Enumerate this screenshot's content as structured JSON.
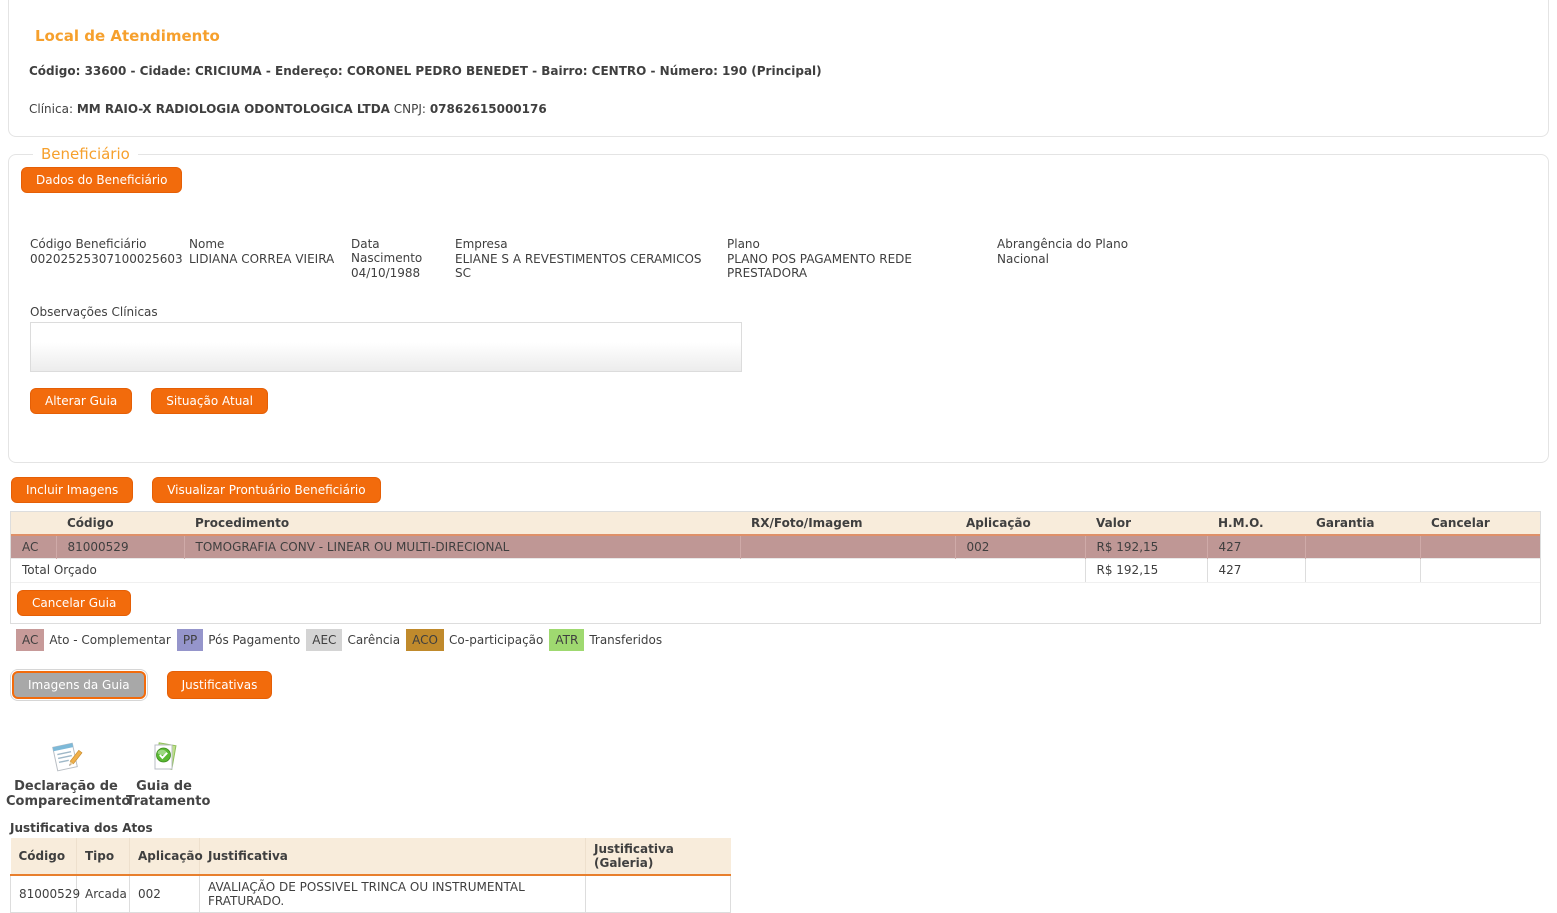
{
  "local_atendimento": {
    "title": "Local de Atendimento",
    "info_line": "Código: 33600 - Cidade: CRICIUMA - Endereço: CORONEL PEDRO BENEDET - Bairro: CENTRO - Número: 190 (Principal)",
    "clinica_label": "Clínica:",
    "clinica_nome": "MM RAIO-X RADIOLOGIA ODONTOLOGICA LTDA",
    "cnpj_label": "CNPJ:",
    "cnpj_valor": "07862615000176"
  },
  "beneficiario": {
    "legend": "Beneficiário",
    "dados_button": "Dados do Beneficiário",
    "fields": [
      {
        "label": "Código Beneficiário",
        "value": "00202525307100025603"
      },
      {
        "label": "Nome",
        "value": "LIDIANA CORREA VIEIRA"
      },
      {
        "label": "Data Nascimento",
        "value": "04/10/1988"
      },
      {
        "label": "Empresa",
        "value": "ELIANE S A REVESTIMENTOS CERAMICOS SC"
      },
      {
        "label": "Plano",
        "value": "PLANO POS PAGAMENTO REDE PRESTADORA"
      },
      {
        "label": "Abrangência do Plano",
        "value": "Nacional"
      }
    ],
    "observacoes_label": "Observações Clínicas",
    "observacoes_value": "",
    "alterar_guia_button": "Alterar Guia",
    "situacao_atual_button": "Situação Atual"
  },
  "actions": {
    "incluir_imagens": "Incluir Imagens",
    "visualizar_prontuario": "Visualizar Prontuário Beneficiário",
    "cancelar_guia": "Cancelar Guia",
    "imagens_da_guia": "Imagens da Guia",
    "justificativas": "Justificativas"
  },
  "procedimentos_table": {
    "headers": [
      "",
      "Código",
      "Procedimento",
      "RX/Foto/Imagem",
      "Aplicação",
      "Valor",
      "H.M.O.",
      "Garantia",
      "Cancelar"
    ],
    "rows": [
      {
        "tipo": "AC",
        "codigo": "81000529",
        "procedimento": "TOMOGRAFIA CONV - LINEAR OU MULTI-DIRECIONAL",
        "rx_foto_imagem": "",
        "aplicacao": "002",
        "valor": "R$ 192,15",
        "hmo": "427",
        "garantia": "",
        "cancelar": ""
      }
    ],
    "total": {
      "label": "Total Orçado",
      "valor": "R$ 192,15",
      "hmo": "427"
    }
  },
  "legend": {
    "items": [
      {
        "code": "AC",
        "label": "Ato - Complementar",
        "color": "#c79a99"
      },
      {
        "code": "PP",
        "label": "Pós Pagamento",
        "color": "#9595cb"
      },
      {
        "code": "AEC",
        "label": "Carência",
        "color": "#d4d4d4"
      },
      {
        "code": "ACO",
        "label": "Co-participação",
        "color": "#c08a2c"
      },
      {
        "code": "ATR",
        "label": "Transferidos",
        "color": "#9fd970"
      }
    ]
  },
  "shortcuts": [
    {
      "icon": "document-pencil-icon",
      "line1": "Declaração de",
      "line2": "Comparecimento"
    },
    {
      "icon": "document-check-icon",
      "line1": "Guia de",
      "line2": "Tratamento"
    }
  ],
  "justificativa_atos": {
    "title": "Justificativa dos Atos",
    "headers": [
      "Código",
      "Tipo",
      "Aplicação",
      "Justificativa",
      "Justificativa (Galeria)"
    ],
    "rows": [
      {
        "codigo": "81000529",
        "tipo": "Arcada",
        "aplicacao": "002",
        "justificativa": "AVALIAÇÃO DE POSSIVEL TRINCA OU INSTRUMENTAL FRATURADO.",
        "justificativa_galeria": ""
      }
    ]
  },
  "colors": {
    "accent_orange": "#f26b0c",
    "heading_orange": "#f6a02d",
    "table_header_bg": "#f8ecdb",
    "row_highlight": "#bf9795",
    "row_border_orange": "#df9068"
  }
}
